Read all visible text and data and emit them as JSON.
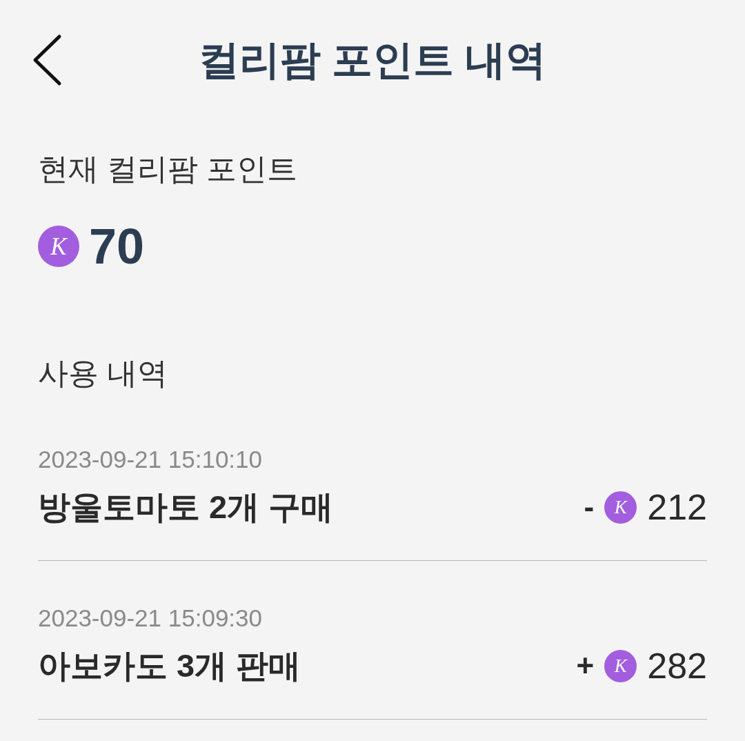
{
  "header": {
    "title": "컬리팜 포인트 내역"
  },
  "balance": {
    "label": "현재 컬리팜 포인트",
    "coin_symbol": "K",
    "amount": "70"
  },
  "history": {
    "label": "사용 내역",
    "entries": [
      {
        "date": "2023-09-21 15:10:10",
        "title": "방울토마토 2개 구매",
        "sign": "-",
        "coin_symbol": "K",
        "amount": "212"
      },
      {
        "date": "2023-09-21 15:09:30",
        "title": "아보카도 3개 판매",
        "sign": "+",
        "coin_symbol": "K",
        "amount": "282"
      }
    ]
  }
}
